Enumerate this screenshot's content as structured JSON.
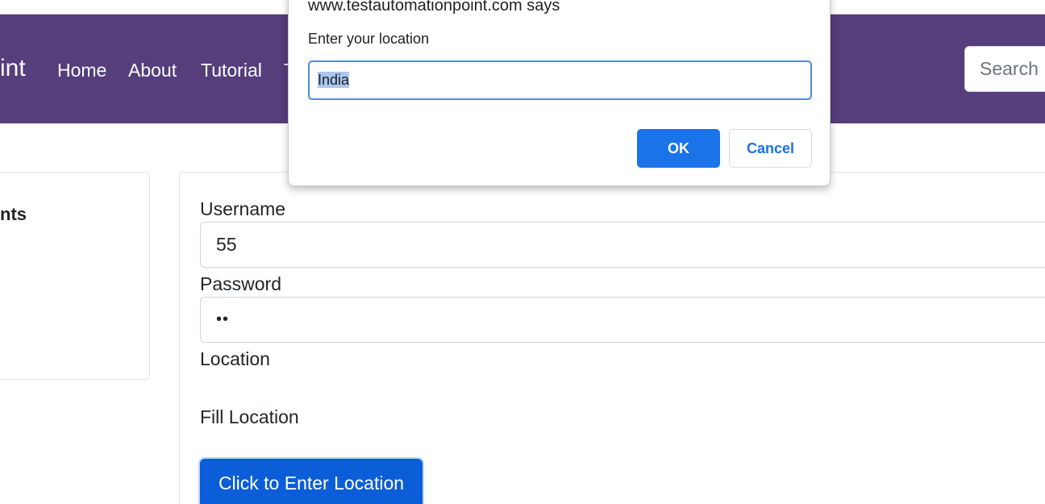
{
  "navbar": {
    "brand_fragment": "int",
    "links": [
      "Home",
      "About",
      "Tutorial",
      "T"
    ],
    "search_placeholder": "Search"
  },
  "sidebar": {
    "title_fragment": "nts"
  },
  "form": {
    "username_label": "Username",
    "username_value": "55",
    "password_label": "Password",
    "password_mask": "••",
    "location_label": "Location",
    "fill_location_text": "Fill Location",
    "enter_location_button": "Click to Enter Location"
  },
  "dialog": {
    "host_text": "www.testautomationpoint.com says",
    "message": "Enter your location",
    "input_value": "India",
    "ok_label": "OK",
    "cancel_label": "Cancel"
  },
  "colors": {
    "navbar_bg": "#563d7c",
    "primary_button": "#0b5ed7",
    "dialog_ok": "#1a73e8"
  }
}
